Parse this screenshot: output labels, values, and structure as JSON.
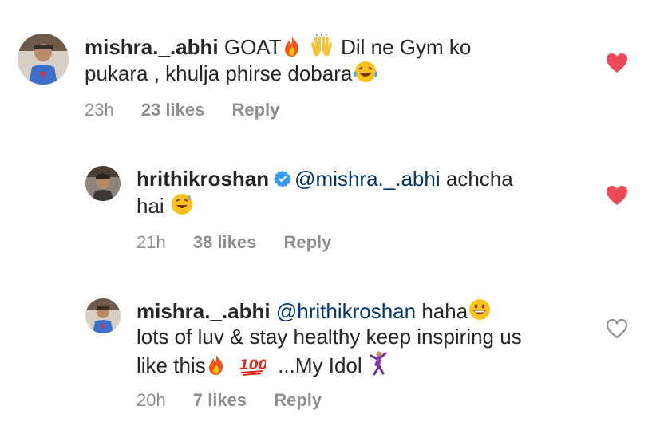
{
  "comments": [
    {
      "username": "mishra._.abhi",
      "text_line1": "GOAT",
      "text_line1b": "Dil ne Gym ko",
      "text_line2": "pukara , khulja  phirse dobara",
      "time": "23h",
      "likes": "23 likes",
      "reply": "Reply",
      "liked": true,
      "icons": [
        "fire-emoji",
        "raised-hands-emoji",
        "laughing-tears-emoji"
      ]
    },
    {
      "username": "hrithikroshan",
      "mention": "@mishra._.abhi",
      "text_line1": "achcha",
      "text_line2": "hai",
      "time": "21h",
      "likes": "38 likes",
      "reply": "Reply",
      "liked": true,
      "verified": true,
      "icons": [
        "sweat-smile-emoji"
      ]
    },
    {
      "username": "mishra._.abhi",
      "mention": "@hrithikroshan",
      "text_line1": "haha",
      "text_line2": "lots of luv & stay healthy keep inspiring us",
      "text_line3a": "like this",
      "text_line3b": "...My Idol",
      "time": "20h",
      "likes": "7 likes",
      "reply": "Reply",
      "liked": false,
      "icons": [
        "grinning-emoji",
        "fire-emoji",
        "hundred-points-emoji",
        "dancer-emoji"
      ]
    }
  ],
  "colors": {
    "heart_liked": "#ed4956",
    "meta": "#8e8e8e",
    "mention": "#00376b",
    "verified": "#3897f0"
  }
}
